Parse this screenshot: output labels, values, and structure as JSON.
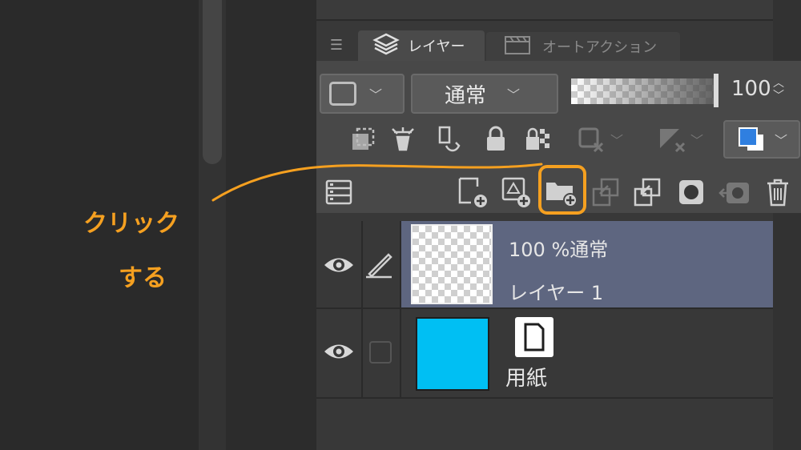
{
  "tabs": {
    "active_label": "レイヤー",
    "inactive_label": "オートアクション"
  },
  "toolbar": {
    "blend_mode": "通常",
    "opacity_value": "100",
    "opacity_level": 1.0
  },
  "layers": [
    {
      "info": "100 %通常",
      "name": "レイヤー 1",
      "selected": true
    },
    {
      "info": "",
      "name": "用紙",
      "selected": false,
      "paper_color": "#00bff3"
    }
  ],
  "annotation": {
    "line1": "クリック",
    "line2": "する",
    "color": "#f5a020"
  },
  "colors": {
    "panel_bg": "#383838",
    "selected_row": "#5e6680",
    "accent_blue": "#2f7fe0"
  }
}
